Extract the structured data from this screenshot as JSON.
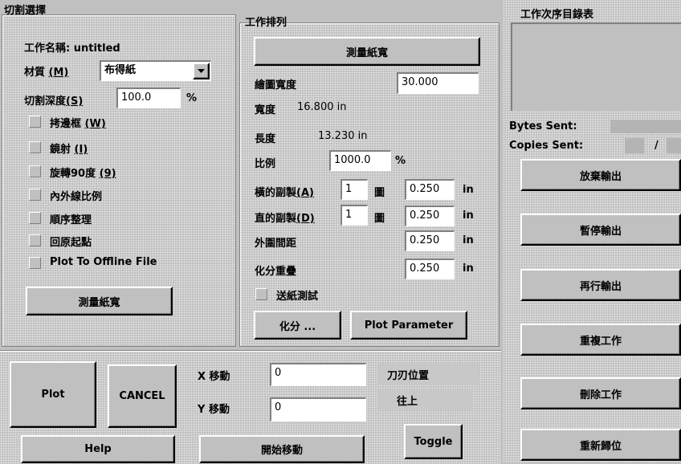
{
  "cut_select": {
    "title": "切割選擇",
    "job_name": "工作名稱: untitled",
    "material_label": "材質",
    "material_key": "(M)",
    "material_value": "布得紙",
    "depth_label": "切割深度",
    "depth_key": "(S)",
    "depth_value": "100.0",
    "depth_unit": "%",
    "options": [
      {
        "label": "拷邊框",
        "key": "(W)"
      },
      {
        "label": "鏡射",
        "key": "(I)"
      },
      {
        "label": "旋轉90度",
        "key": "(9)"
      },
      {
        "label": "內外線比例",
        "key": ""
      },
      {
        "label": "順序整理",
        "key": ""
      },
      {
        "label": "回原起點",
        "key": ""
      },
      {
        "label": "Plot To Offline File",
        "key": ""
      }
    ],
    "measure_button": "測量紙寬"
  },
  "job_arrange": {
    "title": "工作排列",
    "measure_button": "測量紙寬",
    "draw_width_label": "繪圖寬度",
    "draw_width_value": "30.000",
    "width_label": "寬度",
    "width_value": "16.800 in",
    "length_label": "長度",
    "length_value": "13.230 in",
    "scale_label": "比例",
    "scale_value": "1000.0",
    "scale_unit": "%",
    "h_copies_label": "橫的副製",
    "h_copies_key": "(A)",
    "h_copies_value": "1",
    "h_copies_unit": "圖",
    "h_gap_value": "0.250",
    "h_gap_unit": "in",
    "v_copies_label": "直的副製",
    "v_copies_key": "(D)",
    "v_copies_value": "1",
    "v_copies_unit": "圖",
    "v_gap_value": "0.250",
    "v_gap_unit": "in",
    "outer_gap_label": "外圍間距",
    "outer_gap_value": "0.250",
    "outer_gap_unit": "in",
    "divide_overlap_label": "化分重疊",
    "divide_overlap_value": "0.250",
    "divide_overlap_unit": "in",
    "paper_test_label": "送紙測試",
    "divide_button": "化分 ...",
    "plot_parameter_button": "Plot Parameter"
  },
  "queue": {
    "title": "工作次序目錄表",
    "bytes_sent_label": "Bytes Sent:",
    "copies_sent_label": "Copies Sent:",
    "copies_sep": "/",
    "buttons": [
      "放棄輸出",
      "暫停輸出",
      "再行輸出",
      "重複工作",
      "刪除工作",
      "重新歸位"
    ]
  },
  "bottom": {
    "plot_button": "Plot",
    "cancel_button": "CANCEL",
    "help_button": "Help",
    "x_move_label": "X 移動",
    "x_move_value": "0",
    "y_move_label": "Y 移動",
    "y_move_value": "0",
    "start_move_button": "開始移動",
    "knife_pos_label": "刀刃位置",
    "direction_value": "往上",
    "toggle_button": "Toggle"
  }
}
